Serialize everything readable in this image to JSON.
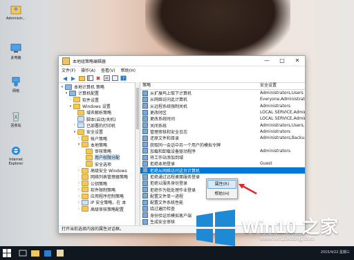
{
  "desktop": {
    "icons": [
      {
        "label": "Administr...",
        "icon": "user-folder-icon"
      },
      {
        "label": "此电脑",
        "icon": "computer-icon"
      },
      {
        "label": "网络",
        "icon": "network-icon"
      },
      {
        "label": "回收站",
        "icon": "recycle-bin-icon"
      },
      {
        "label": "Internet Explorer",
        "icon": "internet-explorer-icon"
      }
    ]
  },
  "window": {
    "title": "本地组策略编辑器",
    "menu": [
      "文件(F)",
      "操作(A)",
      "查看(V)",
      "帮助(H)"
    ],
    "tree": [
      {
        "label": "本地计算机 策略",
        "indent": 0,
        "expander": "▾",
        "icon": "pc"
      },
      {
        "label": "计算机配置",
        "indent": 1,
        "expander": "▾",
        "icon": "pc"
      },
      {
        "label": "软件设置",
        "indent": 2,
        "expander": "›",
        "icon": "folder"
      },
      {
        "label": "Windows 设置",
        "indent": 2,
        "expander": "▾",
        "icon": "folder"
      },
      {
        "label": "域名解析策略",
        "indent": 3,
        "expander": "",
        "icon": "folder"
      },
      {
        "label": "脚本(启动/关机)",
        "indent": 3,
        "expander": "",
        "icon": "sheet"
      },
      {
        "label": "已部署的打印机",
        "indent": 3,
        "expander": "›",
        "icon": "sheet"
      },
      {
        "label": "安全设置",
        "indent": 3,
        "expander": "▾",
        "icon": "folder"
      },
      {
        "label": "帐户策略",
        "indent": 4,
        "expander": "›",
        "icon": "folder"
      },
      {
        "label": "本地策略",
        "indent": 4,
        "expander": "▾",
        "icon": "folder"
      },
      {
        "label": "审核策略",
        "indent": 5,
        "expander": "",
        "icon": "folder"
      },
      {
        "label": "用户权限分配",
        "indent": 5,
        "expander": "",
        "icon": "folder",
        "selected": true
      },
      {
        "label": "安全选项",
        "indent": 5,
        "expander": "",
        "icon": "folder"
      },
      {
        "label": "高级安全 Windows",
        "indent": 4,
        "expander": "›",
        "icon": "folder"
      },
      {
        "label": "网络列表管理器策略",
        "indent": 4,
        "expander": "",
        "icon": "folder"
      },
      {
        "label": "公钥策略",
        "indent": 4,
        "expander": "›",
        "icon": "folder"
      },
      {
        "label": "软件限制策略",
        "indent": 4,
        "expander": "›",
        "icon": "folder"
      },
      {
        "label": "应用程序控制策略",
        "indent": 4,
        "expander": "›",
        "icon": "folder"
      },
      {
        "label": "IP 安全策略，在 本",
        "indent": 4,
        "expander": "›",
        "icon": "sheet"
      },
      {
        "label": "高级审核策略配置",
        "indent": 4,
        "expander": "›",
        "icon": "folder"
      }
    ],
    "list": {
      "headers": [
        "策略",
        "安全设置"
      ],
      "rows": [
        {
          "policy": "从扩展坞上取下计算机",
          "setting": "Administrators,Users"
        },
        {
          "policy": "从网络访问此计算机",
          "setting": "Everyone,Administrat..."
        },
        {
          "policy": "从远程系统强制关机",
          "setting": "Administrators"
        },
        {
          "policy": "更改时区",
          "setting": "LOCAL SERVICE,Admini..."
        },
        {
          "policy": "更改系统时间",
          "setting": "LOCAL SERVICE,Admini..."
        },
        {
          "policy": "关闭系统",
          "setting": "Administrators,Users,..."
        },
        {
          "policy": "管理审核和安全日志",
          "setting": "Administrators"
        },
        {
          "policy": "还原文件和目录",
          "setting": "Administrators,Backu..."
        },
        {
          "policy": "获取同一会话中另一个用户的模拟令牌",
          "setting": ""
        },
        {
          "policy": "加载和卸载设备驱动程序",
          "setting": "Administrators"
        },
        {
          "policy": "将工作站添加到域",
          "setting": ""
        },
        {
          "policy": "拒绝本地登录",
          "setting": "Guest"
        },
        {
          "policy": "拒绝从网络访问这台计算机",
          "setting": "",
          "selected": true
        },
        {
          "policy": "拒绝通过远程桌面服务登录",
          "setting": ""
        },
        {
          "policy": "拒绝以服务身份登录",
          "setting": ""
        },
        {
          "policy": "拒绝作为批处理作业登录",
          "setting": ""
        },
        {
          "policy": "配置文件单一进程",
          "setting": ""
        },
        {
          "policy": "配置文件系统性能",
          "setting": ""
        },
        {
          "policy": "绕过遍历检查",
          "setting": ""
        },
        {
          "policy": "身份验证后模拟客户端",
          "setting": ""
        },
        {
          "policy": "生成安全审核",
          "setting": ""
        }
      ]
    },
    "context_menu": [
      "属性(R)",
      "帮助(H)"
    ],
    "status": "打开当前选择内容的属性对话框。"
  },
  "taskbar": {
    "clock": "2015/4/22 星期三"
  },
  "watermark": {
    "brand": "Win10 之家",
    "url": "www.win10xitong.com"
  },
  "colors": {
    "selection": "#0078d7",
    "taskbar": "#11171f",
    "brand_blue": "#1e8ad6"
  }
}
